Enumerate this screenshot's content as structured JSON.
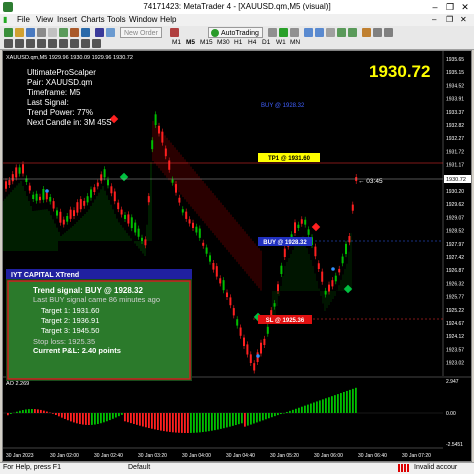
{
  "window": {
    "title": "74171423: MetaTrader 4 - [XAUUSD.qm,M5 (visual)]",
    "controls": [
      "–",
      "❐",
      "✕"
    ]
  },
  "menu": [
    "File",
    "View",
    "Insert",
    "Charts",
    "Tools",
    "Window",
    "Help"
  ],
  "toolbar": {
    "new_order": "New Order",
    "autotrading": "AutoTrading",
    "timeframes": [
      "M1",
      "M5",
      "M15",
      "M30",
      "H1",
      "H4",
      "D1",
      "W1",
      "MN"
    ]
  },
  "chart": {
    "header": "XAUUSD.qm,M5  1929.96 1930.09 1929.96 1930.72",
    "big_price": "1930.72",
    "info_lines": [
      "UltimateProScalper",
      "Pair: XAUUSD.qm",
      "Timeframe: M5",
      "Last Signal:",
      "Trend Power: 77%",
      "Next Candle in: 3M 45S"
    ],
    "buy_note": "BUY @ 1928.32",
    "tp1_label": "TP1 @ 1931.60",
    "buy_label": "BUY @ 1928.32",
    "sl_label": "SL @ 1925.36",
    "countdown": "← 03:45",
    "price_axis": [
      "1935.65",
      "1935.15",
      "1934.52",
      "1933.91",
      "1933.37",
      "1932.82",
      "1932.27",
      "1931.72",
      "1931.17",
      "1930.72",
      "1930.20",
      "1929.62",
      "1929.07",
      "1928.52",
      "1927.97",
      "1927.42",
      "1926.87",
      "1926.32",
      "1925.77",
      "1925.22",
      "1924.67",
      "1924.12",
      "1923.57",
      "1923.02"
    ],
    "time_axis": [
      "30 Jan 2023",
      "30 Jan 02:00",
      "30 Jan 02:40",
      "30 Jan 03:20",
      "30 Jan 04:00",
      "30 Jan 04:40",
      "30 Jan 05:20",
      "30 Jan 06:00",
      "30 Jan 06:40",
      "30 Jan 07:20"
    ],
    "colors": {
      "bull": "#00c000",
      "bear": "#ff2020",
      "cloud_up": "#00b000",
      "cloud_down": "#d00000",
      "price_big": "#ffff00"
    }
  },
  "panel": {
    "header": "IYT CAPITAL XTrend",
    "trend_signal": "Trend signal: BUY @ 1928.32",
    "last_signal": "Last BUY signal came 86 minutes ago",
    "targets": [
      "Target 1: 1931.60",
      "Target 2: 1936.91",
      "Target 3: 1945.50"
    ],
    "stop_loss": "Stop loss: 1925.35",
    "pnl": "Current P&L: 2.40 points"
  },
  "ao": {
    "label": "AO 2.269",
    "scale": [
      "2.947",
      "0.00",
      "-2.5451"
    ]
  },
  "status": {
    "help": "For Help, press F1",
    "profile": "Default",
    "account": "Invalid accour"
  }
}
